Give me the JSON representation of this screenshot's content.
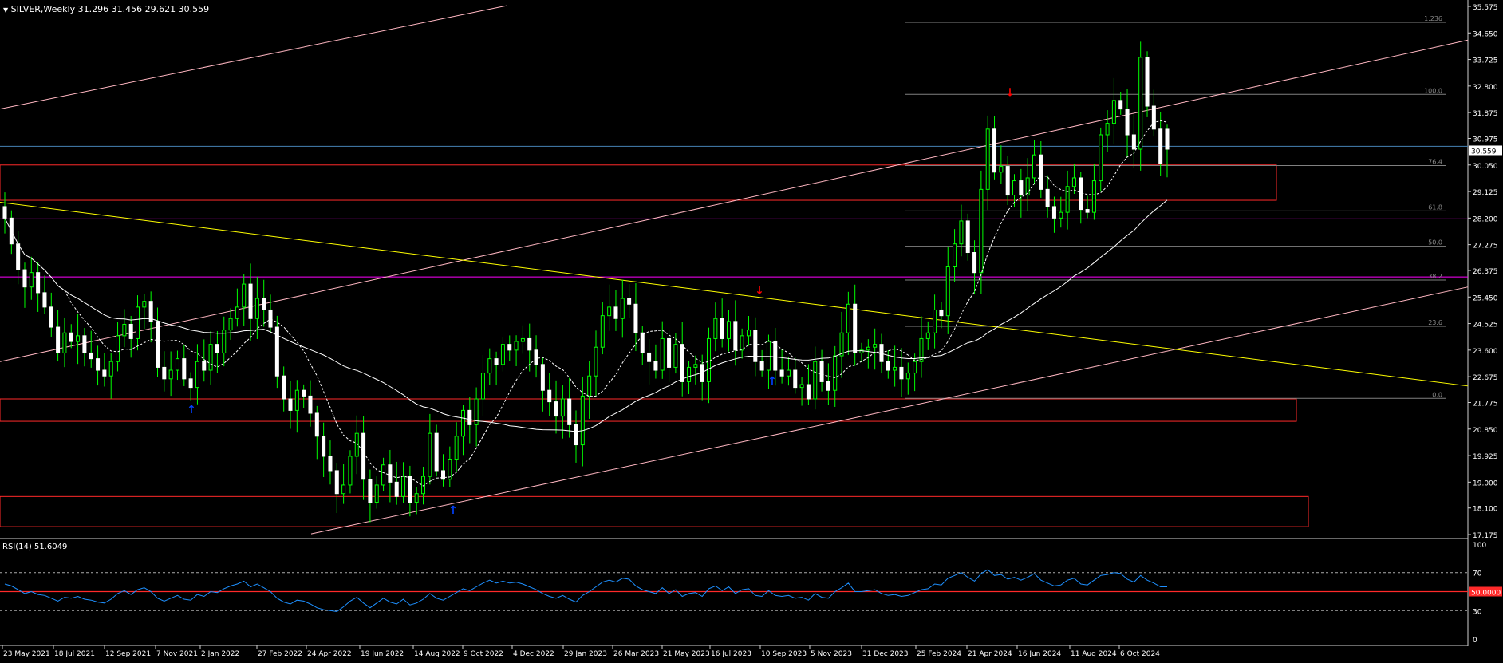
{
  "header": {
    "symbol_line": "SILVER,Weekly  31.296 31.456 29.621 30.559",
    "indicator_line": "RSI(14) 51.6049"
  },
  "colors": {
    "background": "#000000",
    "bull_candle": "#00ff00",
    "bear_candle": "#ffffff",
    "rsi_line": "#1e90ff",
    "zone": "#ff2a2a",
    "channel": "#ffb6c1",
    "trendline": "#ffff00",
    "fib": "#808080",
    "magenta_level": "#ff00ff",
    "ema_fast": "#ffffff",
    "sma_slow": "#ffffff",
    "arrow_up": "#0040ff",
    "arrow_down": "#ff0000"
  },
  "chart_data": [
    {
      "type": "candlestick",
      "title": "SILVER,Weekly",
      "ohlc_last": {
        "open": 31.296,
        "high": 31.456,
        "low": 29.621,
        "close": 30.559
      },
      "last_price_label": "30.559",
      "ylim": [
        17.175,
        35.575
      ],
      "yticks": [
        "35.575",
        "34.650",
        "33.725",
        "32.800",
        "31.875",
        "30.975",
        "30.050",
        "29.125",
        "28.200",
        "27.275",
        "26.375",
        "25.450",
        "24.525",
        "23.600",
        "22.675",
        "21.775",
        "20.850",
        "19.925",
        "19.000",
        "18.100",
        "17.175"
      ],
      "xticks": [
        "23 May 2021",
        "18 Jul 2021",
        "12 Sep 2021",
        "7 Nov 2021",
        "2 Jan 2022",
        "27 Feb 2022",
        "24 Apr 2022",
        "19 Jun 2022",
        "14 Aug 2022",
        "9 Oct 2022",
        "4 Dec 2022",
        "29 Jan 2023",
        "26 Mar 2023",
        "21 May 2023",
        "16 Jul 2023",
        "10 Sep 2023",
        "5 Nov 2023",
        "31 Dec 2023",
        "25 Feb 2024",
        "21 Apr 2024",
        "16 Jun 2024",
        "11 Aug 2024",
        "6 Oct 2024"
      ],
      "series": [
        {
          "name": "Close (weekly)",
          "values": [
            28.2,
            27.3,
            26.4,
            25.8,
            26.3,
            25.6,
            25.1,
            24.4,
            23.5,
            24.2,
            23.9,
            24.1,
            23.5,
            23.3,
            22.9,
            22.7,
            23.2,
            24.1,
            24.5,
            24.0,
            25.1,
            25.3,
            24.6,
            23.0,
            22.6,
            22.9,
            23.3,
            22.6,
            22.3,
            23.2,
            22.9,
            23.8,
            23.5,
            24.3,
            24.7,
            25.1,
            25.9,
            24.7,
            25.4,
            25.0,
            24.4,
            22.7,
            21.9,
            21.5,
            22.2,
            22.0,
            21.4,
            20.6,
            19.9,
            19.4,
            18.6,
            18.9,
            19.9,
            20.7,
            19.1,
            18.3,
            18.9,
            19.6,
            19.0,
            18.5,
            19.2,
            18.3,
            18.6,
            19.2,
            20.7,
            19.4,
            19.1,
            19.8,
            20.6,
            21.5,
            21.0,
            21.9,
            22.8,
            23.3,
            23.1,
            23.8,
            23.6,
            23.9,
            24.0,
            23.6,
            23.1,
            22.2,
            21.8,
            21.3,
            21.9,
            21.0,
            20.3,
            22.0,
            22.7,
            23.7,
            24.8,
            25.1,
            24.7,
            25.4,
            25.2,
            24.2,
            23.5,
            23.2,
            22.9,
            24.0,
            23.0,
            23.8,
            22.5,
            23.0,
            23.1,
            22.5,
            24.0,
            24.7,
            24.0,
            24.6,
            23.6,
            24.1,
            24.3,
            23.2,
            22.9,
            23.9,
            22.9,
            22.7,
            22.9,
            22.3,
            22.4,
            21.9,
            23.2,
            22.5,
            22.2,
            23.4,
            24.2,
            25.2,
            23.5,
            23.6,
            23.7,
            23.8,
            23.2,
            22.9,
            23.0,
            22.6,
            22.8,
            23.2,
            24.0,
            24.2,
            25.0,
            24.8,
            26.5,
            27.3,
            28.1,
            27.0,
            26.3,
            29.2,
            31.3,
            29.8,
            30.0,
            29.0,
            29.5,
            29.0,
            29.6,
            30.4,
            29.2,
            28.6,
            28.2,
            28.4,
            29.3,
            29.6,
            28.5,
            28.4,
            29.5,
            31.1,
            31.5,
            32.3,
            32.0,
            31.1,
            30.6,
            33.8,
            32.1,
            31.3,
            30.1,
            30.6
          ]
        },
        {
          "name": "RSI(14)",
          "values": [
            58,
            56,
            52,
            48,
            50,
            47,
            46,
            43,
            40,
            44,
            43,
            45,
            42,
            41,
            39,
            38,
            42,
            48,
            51,
            47,
            52,
            54,
            50,
            43,
            40,
            43,
            46,
            42,
            41,
            47,
            45,
            50,
            49,
            53,
            56,
            58,
            61,
            55,
            58,
            54,
            50,
            43,
            39,
            37,
            41,
            40,
            37,
            33,
            31,
            30,
            29,
            34,
            40,
            44,
            38,
            33,
            38,
            43,
            39,
            37,
            42,
            36,
            38,
            42,
            48,
            43,
            41,
            45,
            49,
            53,
            51,
            55,
            59,
            62,
            59,
            61,
            59,
            60,
            58,
            55,
            52,
            48,
            45,
            43,
            46,
            42,
            39,
            46,
            50,
            55,
            60,
            62,
            60,
            64,
            63,
            56,
            52,
            50,
            48,
            54,
            48,
            52,
            45,
            48,
            49,
            45,
            53,
            56,
            51,
            55,
            48,
            52,
            53,
            46,
            45,
            51,
            46,
            45,
            46,
            43,
            44,
            41,
            48,
            44,
            43,
            50,
            54,
            59,
            50,
            50,
            51,
            52,
            48,
            46,
            47,
            45,
            46,
            49,
            52,
            53,
            58,
            57,
            64,
            67,
            70,
            65,
            61,
            69,
            73,
            67,
            68,
            63,
            65,
            62,
            65,
            69,
            62,
            59,
            56,
            57,
            62,
            64,
            58,
            57,
            62,
            67,
            68,
            70,
            69,
            63,
            60,
            67,
            62,
            59,
            55,
            55
          ],
          "levels": [
            30,
            50,
            70
          ],
          "ylim": [
            0,
            100
          ],
          "yticks": [
            "100",
            "70",
            "50.0000",
            "30",
            "0"
          ]
        }
      ],
      "fibonacci": {
        "labels": [
          "1.236",
          "100.0",
          "76.4",
          "61.8",
          "50.0",
          "38.2",
          "23.6",
          "0.0"
        ]
      },
      "signals": {
        "up_arrows": 3,
        "down_arrows": 2
      }
    }
  ]
}
